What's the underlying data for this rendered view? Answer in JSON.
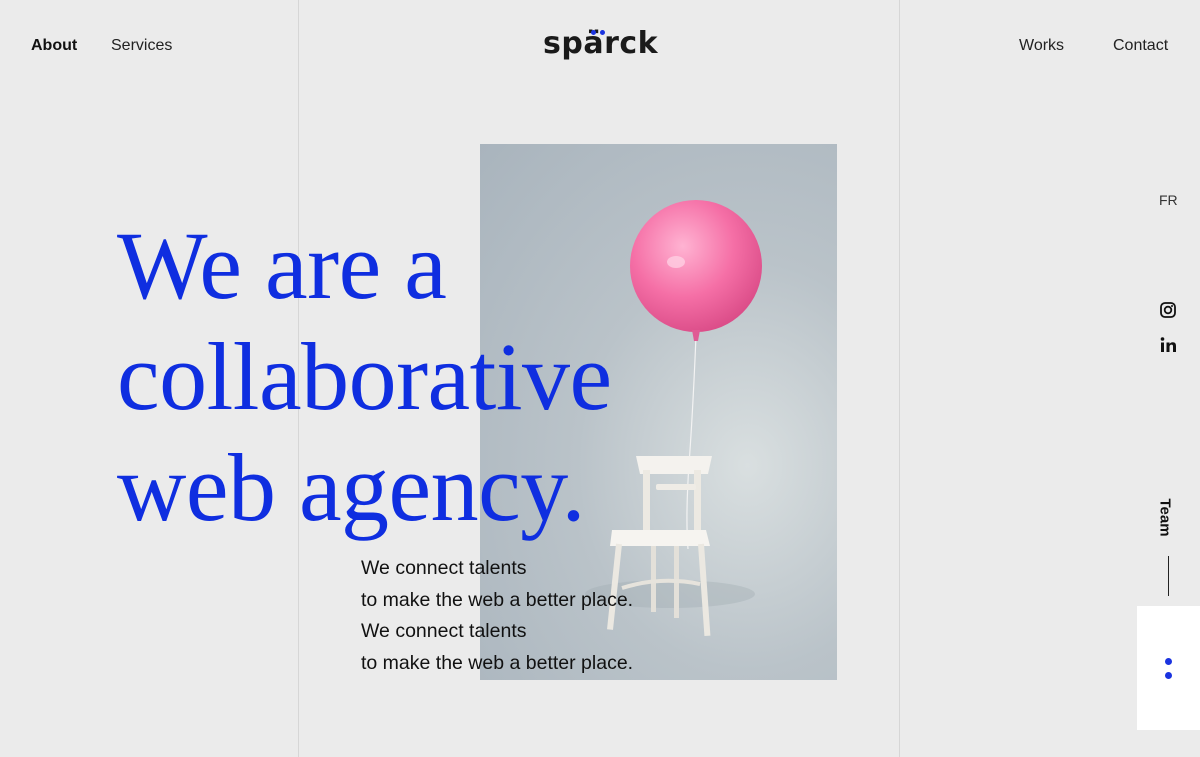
{
  "header": {
    "nav_left": [
      "About",
      "Services"
    ],
    "nav_right": [
      "Works",
      "Contact"
    ],
    "logo": "spärck",
    "logo_accent_color": "#1a33e0"
  },
  "hero": {
    "headline_lines": [
      "We are a",
      "collaborative",
      "web agency."
    ],
    "headline_color": "#0f2ee0",
    "tagline_lines": [
      "We connect talents",
      "to make the web a better place.",
      "We connect talents",
      "to make the web a better place."
    ],
    "image": "pink balloon tied to white wooden chair"
  },
  "sidebar": {
    "language": "FR",
    "social_icons": [
      "instagram-icon",
      "linkedin-icon"
    ],
    "team_label": "Team"
  },
  "background_color": "#ebebeb"
}
